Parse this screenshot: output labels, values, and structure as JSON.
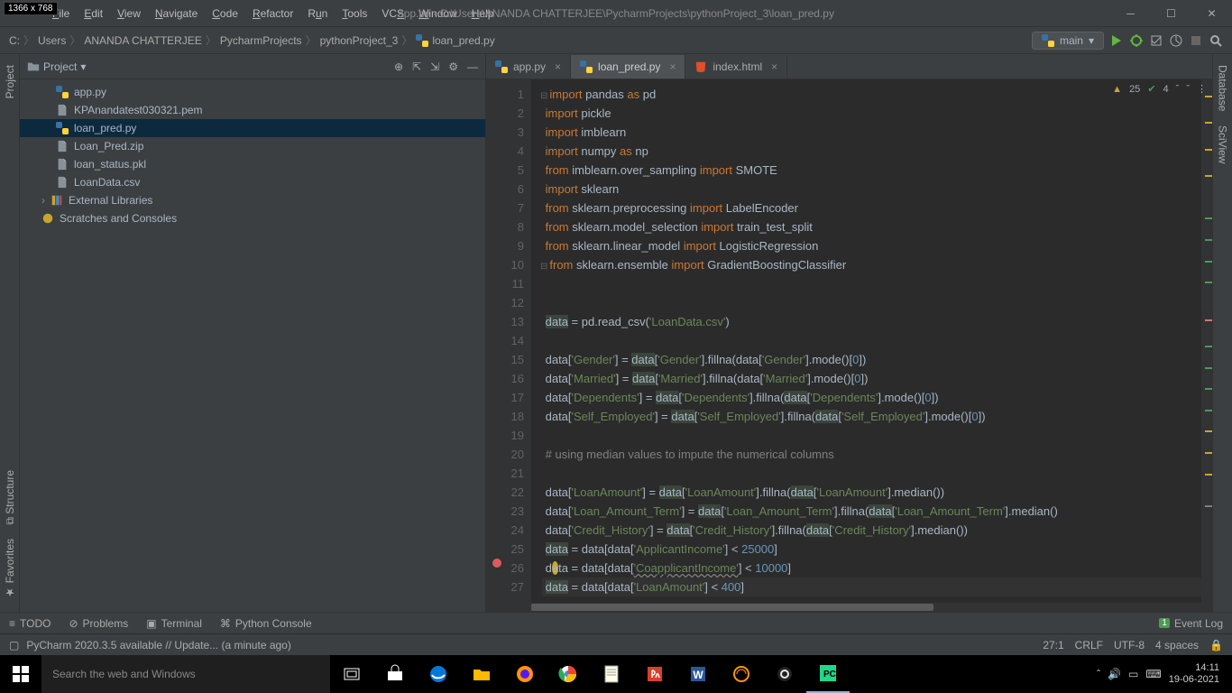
{
  "window": {
    "dim_tag": "1366 x 768",
    "title": "app.py - C:\\Users\\ANANDA CHATTERJEE\\PycharmProjects\\pythonProject_3\\loan_pred.py"
  },
  "menu": [
    "File",
    "Edit",
    "View",
    "Navigate",
    "Code",
    "Refactor",
    "Run",
    "Tools",
    "VCS",
    "Window",
    "Help"
  ],
  "breadcrumb": [
    "C:",
    "Users",
    "ANANDA CHATTERJEE",
    "PycharmProjects",
    "pythonProject_3",
    "loan_pred.py"
  ],
  "run_config": {
    "label": "main"
  },
  "inspections": {
    "warnings": "25",
    "weak": "4"
  },
  "project": {
    "title": "Project",
    "files": [
      {
        "name": "app.py",
        "type": "py"
      },
      {
        "name": "KPAnandatest030321.pem",
        "type": "file"
      },
      {
        "name": "loan_pred.py",
        "type": "py",
        "selected": true
      },
      {
        "name": "Loan_Pred.zip",
        "type": "file"
      },
      {
        "name": "loan_status.pkl",
        "type": "file"
      },
      {
        "name": "LoanData.csv",
        "type": "file"
      }
    ],
    "libs": "External Libraries",
    "scratches": "Scratches and Consoles"
  },
  "tabs": [
    {
      "label": "app.py",
      "type": "py"
    },
    {
      "label": "loan_pred.py",
      "type": "py",
      "active": true
    },
    {
      "label": "index.html",
      "type": "html"
    }
  ],
  "code": {
    "lines": [
      {
        "n": 1,
        "html": "<span class='kw'>import</span> pandas <span class='kw'>as</span> pd",
        "fold": true
      },
      {
        "n": 2,
        "html": "<span class='kw'>import</span> pickle"
      },
      {
        "n": 3,
        "html": "<span class='kw'>import</span> imblearn"
      },
      {
        "n": 4,
        "html": "<span class='kw'>import</span> numpy <span class='kw'>as</span> np"
      },
      {
        "n": 5,
        "html": "<span class='kw'>from</span> imblearn.over_sampling <span class='kw'>import</span> SMOTE"
      },
      {
        "n": 6,
        "html": "<span class='kw'>import</span> sklearn"
      },
      {
        "n": 7,
        "html": "<span class='kw'>from</span> sklearn.preprocessing <span class='kw'>import</span> LabelEncoder"
      },
      {
        "n": 8,
        "html": "<span class='kw'>from</span> sklearn.model_selection <span class='kw'>import</span> train_test_split"
      },
      {
        "n": 9,
        "html": "<span class='kw'>from</span> sklearn.linear_model <span class='kw'>import</span> LogisticRegression"
      },
      {
        "n": 10,
        "html": "<span class='kw'>from</span> sklearn.ensemble <span class='kw'>import</span> GradientBoostingClassifier",
        "fold": true
      },
      {
        "n": 11,
        "html": ""
      },
      {
        "n": 12,
        "html": ""
      },
      {
        "n": 13,
        "html": "<span class='warn'>data</span> = pd.read_csv(<span class='str'>'LoanData.csv'</span>)"
      },
      {
        "n": 14,
        "html": ""
      },
      {
        "n": 15,
        "html": "data[<span class='str'>'Gender'</span>] = <span class='warn'>data</span>[<span class='str'>'Gender'</span>].fillna(data[<span class='str'>'Gender'</span>].mode()[<span class='num'>0</span>])"
      },
      {
        "n": 16,
        "html": "data[<span class='str'>'Married'</span>] = <span class='warn'>data</span>[<span class='str'>'Married'</span>].fillna(data[<span class='str'>'Married'</span>].mode()[<span class='num'>0</span>])"
      },
      {
        "n": 17,
        "html": "data[<span class='str'>'Dependents'</span>] = <span class='warn'>data</span>[<span class='str'>'Dependents'</span>].fillna(<span class='warn'>data</span>[<span class='str'>'Dependents'</span>].mode()[<span class='num'>0</span>])"
      },
      {
        "n": 18,
        "html": "data[<span class='str'>'Self_Employed'</span>] = <span class='warn'>data</span>[<span class='str'>'Self_Employed'</span>].fillna(<span class='warn'>data</span>[<span class='str'>'Self_Employed'</span>].mode()[<span class='num'>0</span>])"
      },
      {
        "n": 19,
        "html": ""
      },
      {
        "n": 20,
        "html": "<span class='comment'># using median values to impute the numerical columns</span>"
      },
      {
        "n": 21,
        "html": ""
      },
      {
        "n": 22,
        "html": "data[<span class='str'>'LoanAmount'</span>] = <span class='warn'>data</span>[<span class='str'>'LoanAmount'</span>].fillna(<span class='warn'>data</span>[<span class='str'>'LoanAmount'</span>].median())"
      },
      {
        "n": 23,
        "html": "data[<span class='str'>'Loan_Amount_Term'</span>] = <span class='warn'>data</span>[<span class='str'>'Loan_Amount_Term'</span>].fillna(<span class='warn'>data</span>[<span class='str'>'Loan_Amount_Term'</span>].median()"
      },
      {
        "n": 24,
        "html": "data[<span class='str'>'Credit_History'</span>] = <span class='warn'>data</span>[<span class='str'>'Credit_History'</span>].fillna(<span class='warn'>data</span>[<span class='str'>'Credit_History'</span>].median())"
      },
      {
        "n": 25,
        "html": "<span class='warn'>data</span> = data[data[<span class='str'>'ApplicantIncome'</span>] &lt; <span class='num'>25000</span>]"
      },
      {
        "n": 26,
        "html": "d<span style='background:#c9a62b;border-radius:50%;'>a</span>ta = data[data[<span class='str underline'>'CoapplicantIncome'</span>] &lt; <span class='num'>10000</span>]",
        "bp": true
      },
      {
        "n": 27,
        "html": "<span class='warn'>data</span> = data[data[<span class='str'>'LoanAmount'</span>] &lt; <span class='num'>400</span>]",
        "caret": true
      }
    ]
  },
  "bottom_tools": {
    "todo": "TODO",
    "problems": "Problems",
    "terminal": "Terminal",
    "console": "Python Console",
    "event_log": "Event Log"
  },
  "status": {
    "msg": "PyCharm 2020.3.5 available // Update... (a minute ago)",
    "pos": "27:1",
    "eol": "CRLF",
    "enc": "UTF-8",
    "indent": "4 spaces"
  },
  "taskbar": {
    "search_placeholder": "Search the web and Windows",
    "time": "14:11",
    "date": "19-06-2021"
  }
}
